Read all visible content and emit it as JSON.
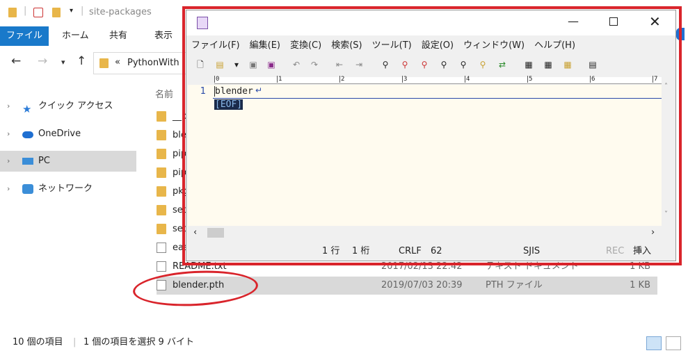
{
  "explorer": {
    "title": "site-packages",
    "ribbon_tabs": [
      "ファイル",
      "ホーム",
      "共有",
      "表示"
    ],
    "address_prefix": "«",
    "address_path": "PythonWith",
    "column_name": "名前",
    "sidebar": [
      {
        "label": "クイック アクセス",
        "icon": "star-icon"
      },
      {
        "label": "OneDrive",
        "icon": "cloud-icon"
      },
      {
        "label": "PC",
        "icon": "pc-icon",
        "selected": true
      },
      {
        "label": "ネットワーク",
        "icon": "network-icon"
      }
    ],
    "files": [
      {
        "name": "__p",
        "date": "",
        "type": "",
        "size": "",
        "kind": "folder"
      },
      {
        "name": "ble",
        "date": "",
        "type": "",
        "size": "",
        "kind": "folder"
      },
      {
        "name": "pip",
        "date": "",
        "type": "",
        "size": "",
        "kind": "folder"
      },
      {
        "name": "pip",
        "date": "",
        "type": "",
        "size": "",
        "kind": "folder"
      },
      {
        "name": "pkg",
        "date": "",
        "type": "",
        "size": "",
        "kind": "folder"
      },
      {
        "name": "setu",
        "date": "",
        "type": "",
        "size": "",
        "kind": "folder"
      },
      {
        "name": "setu",
        "date": "",
        "type": "",
        "size": "",
        "kind": "folder"
      },
      {
        "name": "eas",
        "date": "",
        "type": "",
        "size": "",
        "kind": "file"
      },
      {
        "name": "README.txt",
        "date": "2017/02/13 22:42",
        "type": "テキスト ドキュメント",
        "size": "1 KB",
        "kind": "file"
      },
      {
        "name": "blender.pth",
        "date": "2019/07/03 20:39",
        "type": "PTH ファイル",
        "size": "1 KB",
        "kind": "file",
        "selected": true
      }
    ],
    "status": {
      "count": "10 個の項目",
      "selected": "1 個の項目を選択  9 バイト"
    }
  },
  "editor": {
    "menu": [
      "ファイル(F)",
      "編集(E)",
      "変換(C)",
      "検索(S)",
      "ツール(T)",
      "設定(O)",
      "ウィンドウ(W)",
      "ヘルプ(H)"
    ],
    "ruler": [
      "0",
      "1",
      "2",
      "3",
      "4",
      "5",
      "6",
      "7"
    ],
    "line_number": "1",
    "line_text": "blender",
    "newline_mark": "↵",
    "eof": "[EOF]",
    "status": {
      "line": "1 行",
      "col": "1 桁",
      "eol": "CRLF",
      "code": "62",
      "encoding": "SJIS",
      "rec": "REC",
      "mode": "挿入"
    }
  },
  "colors": {
    "accent": "#1979ca",
    "highlight": "#d9242b",
    "editor_bg": "#fffbef"
  }
}
